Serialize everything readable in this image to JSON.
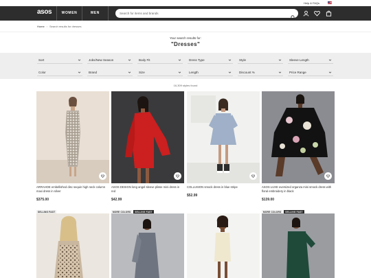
{
  "topbar": {
    "help": "Help & FAQs"
  },
  "nav": {
    "logo": "asos",
    "tabs": [
      "WOMEN",
      "MEN"
    ],
    "search_placeholder": "Search for items and brands"
  },
  "breadcrumb": {
    "home": "Home",
    "current": "Search results for dresses"
  },
  "results": {
    "intro": "Your search results for:",
    "query": "\"Dresses\"",
    "count": "16,309 styles found"
  },
  "filters": [
    "Sort",
    "Jobs/New Season",
    "Body Fit",
    "Dress Type",
    "Style",
    "Sleeve Length",
    "Color",
    "Brand",
    "Size",
    "Length",
    "Discount %",
    "Price Range"
  ],
  "products": [
    {
      "name": "ARRAHOE embellished disc sequin high neck column maxi dress in silver",
      "price": "$375.00",
      "badges": [
        "SELLING FAST"
      ]
    },
    {
      "name": "ASOS DESIGN long angel sleeve plisse mini dress in red",
      "price": "$42.99",
      "badges": [
        "MORE COLORS",
        "SELLING FAST"
      ]
    },
    {
      "name": "COLLUSION smock dress in blue stripe",
      "price": "$52.99",
      "badges": []
    },
    {
      "name": "ASOS LUXE oversized organza mini smock dress with floral embroidery in black",
      "price": "$139.00",
      "badges": [
        "MORE COLORS",
        "SELLING FAST"
      ]
    }
  ],
  "colors": {
    "nav": "#2d2d2d",
    "filter_bar": "#eeeeee",
    "badge_dark": "#2d2d2d",
    "badge_light": "#eeeeee"
  },
  "icons": [
    "search-icon",
    "account-icon",
    "heart-icon",
    "bag-icon",
    "chevron-down-icon",
    "save-heart-icon"
  ]
}
